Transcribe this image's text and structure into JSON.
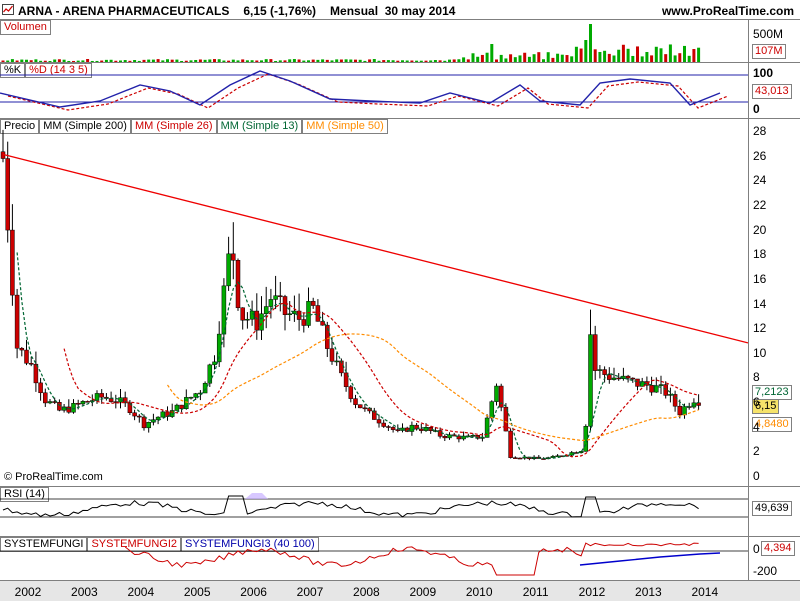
{
  "header": {
    "ticker": "ARNA - ARENA PHARMACEUTICALS",
    "price_change": "6,15 (-1,76%)",
    "period": "Mensual  30 may 2014",
    "site": "www.ProRealTime.com"
  },
  "panes": {
    "volume": {
      "label": "Volumen",
      "ticks": [
        "500M"
      ],
      "value_box": "107M"
    },
    "stoch": {
      "labels": [
        "%K",
        "%D (14 3 5)"
      ],
      "ticks": [
        "100",
        "0"
      ],
      "value_box": "43,013"
    },
    "price": {
      "labels": [
        "Precio",
        "MM (Simple 200)",
        "MM (Simple 26)",
        "MM (Simple 13)",
        "MM (Simple 50)"
      ],
      "ticks": [
        "28",
        "26",
        "24",
        "22",
        "20",
        "18",
        "16",
        "14",
        "12",
        "10",
        "8",
        "6",
        "4",
        "2",
        "0"
      ],
      "value_boxes": [
        "7,2123",
        "6,15",
        "4,8480"
      ],
      "copyright": "© ProRealTime.com"
    },
    "rsi": {
      "label": "RSI (14)",
      "value_box": "49,639"
    },
    "systemfungi": {
      "labels": [
        "SYSTEMFUNGI",
        "SYSTEMFUNGI2",
        "SYSTEMFUNGI3 (40 100)"
      ],
      "ticks": [
        "0",
        "-200"
      ],
      "value_box": "4,394"
    }
  },
  "x_axis": [
    "2002",
    "2003",
    "2004",
    "2005",
    "2006",
    "2007",
    "2008",
    "2009",
    "2010",
    "2011",
    "2012",
    "2013",
    "2014"
  ],
  "colors": {
    "up": "#00aa00",
    "down": "#cc0000",
    "ma200": "#000000",
    "ma26": "#cc0000",
    "ma13": "#006633",
    "ma50": "#ff8c00",
    "trendline": "#ee0000",
    "kline": "#2222aa"
  },
  "chart_data": {
    "type": "candlestick",
    "interval": "monthly",
    "x": [
      "2002-01",
      "2002-04",
      "2002-07",
      "2002-10",
      "2003-01",
      "2003-04",
      "2003-07",
      "2003-10",
      "2004-01",
      "2004-04",
      "2004-07",
      "2004-10",
      "2005-01",
      "2005-04",
      "2005-07",
      "2005-10",
      "2006-01",
      "2006-04",
      "2006-07",
      "2006-10",
      "2007-01",
      "2007-04",
      "2007-07",
      "2007-10",
      "2008-01",
      "2008-04",
      "2008-07",
      "2008-10",
      "2009-01",
      "2009-04",
      "2009-07",
      "2009-10",
      "2010-01",
      "2010-04",
      "2010-07",
      "2010-10",
      "2011-01",
      "2011-04",
      "2011-07",
      "2011-10",
      "2012-01",
      "2012-04",
      "2012-07",
      "2012-10",
      "2013-01",
      "2013-04",
      "2013-07",
      "2013-10",
      "2014-01",
      "2014-04",
      "2014-05"
    ],
    "close": [
      25.8,
      10.5,
      9.0,
      6.2,
      5.3,
      5.6,
      6.1,
      6.4,
      6.2,
      5.5,
      4.2,
      4.8,
      5.2,
      6.1,
      7.0,
      9.8,
      17.5,
      13.0,
      12.5,
      14.5,
      13.2,
      12.8,
      13.5,
      10.5,
      8.0,
      6.0,
      5.0,
      4.3,
      3.5,
      4.0,
      3.8,
      3.3,
      3.2,
      3.1,
      3.2,
      7.5,
      1.6,
      1.5,
      1.4,
      1.5,
      1.8,
      2.1,
      8.6,
      8.1,
      7.8,
      7.5,
      7.3,
      6.8,
      5.2,
      6.3,
      6.15
    ],
    "high_annotations": {
      "2006-02": 20.6,
      "2012-06": 13.5
    },
    "y_range": [
      0,
      28
    ],
    "series_names": [
      "MM (Simple 200)",
      "MM (Simple 26)",
      "MM (Simple 13)",
      "MM (Simple 50)"
    ],
    "last_values": {
      "ma13": 7.2123,
      "price": 6.15,
      "ma50": 4.848
    },
    "trendline": {
      "from": [
        "2002-01",
        26.1
      ],
      "to": [
        "2014-05",
        10.8
      ]
    }
  }
}
